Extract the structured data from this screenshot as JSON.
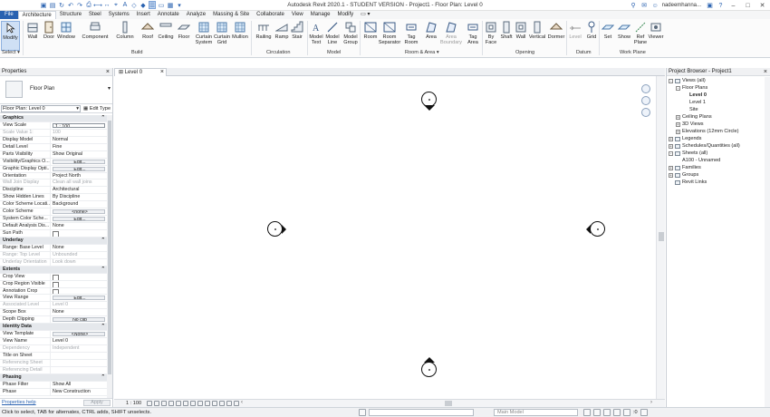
{
  "app": {
    "title": "Autodesk Revit 2020.1 - STUDENT VERSION - Project1 - Floor Plan: Level 0",
    "user": "nadeemhanna..."
  },
  "tabs": [
    "File",
    "Architecture",
    "Structure",
    "Steel",
    "Systems",
    "Insert",
    "Annotate",
    "Analyze",
    "Massing & Site",
    "Collaborate",
    "View",
    "Manage",
    "Modify"
  ],
  "active_tab": "Architecture",
  "ribbon": {
    "modify": "Modify",
    "select": "Select ▾",
    "build": {
      "label": "Build",
      "buttons": [
        "Wall",
        "Door",
        "Window",
        "Component",
        "Column",
        "Roof",
        "Ceiling",
        "Floor",
        "Curtain System",
        "Curtain Grid",
        "Mullion"
      ]
    },
    "circulation": {
      "label": "Circulation",
      "buttons": [
        "Railing",
        "Ramp",
        "Stair"
      ]
    },
    "model": {
      "label": "Model",
      "buttons": [
        "Model Text",
        "Model Line",
        "Model Group"
      ]
    },
    "room_area": {
      "label": "Room & Area ▾",
      "buttons": [
        "Room",
        "Room Separator",
        "Tag Room",
        "Area",
        "Area Boundary",
        "Tag Area"
      ]
    },
    "opening": {
      "label": "Opening",
      "buttons": [
        "By Face",
        "Shaft",
        "Wall",
        "Vertical",
        "Dormer"
      ]
    },
    "datum": {
      "label": "Datum",
      "buttons": [
        "Level",
        "Grid"
      ]
    },
    "work_plane": {
      "label": "Work Plane",
      "buttons": [
        "Set",
        "Show",
        "Ref Plane",
        "Viewer"
      ]
    }
  },
  "properties": {
    "title": "Properties",
    "type_name": "Floor Plan",
    "instance": "Floor Plan: Level 0",
    "edit_type": "Edit Type",
    "help": "Properties help",
    "apply": "Apply",
    "rows": [
      {
        "cat": "Graphics"
      },
      {
        "k": "View Scale",
        "v": "1 : 100",
        "style": "box"
      },
      {
        "k": "Scale Value    1:",
        "v": "100",
        "grey": true
      },
      {
        "k": "Display Model",
        "v": "Normal"
      },
      {
        "k": "Detail Level",
        "v": "Fine"
      },
      {
        "k": "Parts Visibility",
        "v": "Show Original"
      },
      {
        "k": "Visibility/Graphics O...",
        "v": "Edit...",
        "style": "btn"
      },
      {
        "k": "Graphic Display Opti...",
        "v": "Edit...",
        "style": "btn"
      },
      {
        "k": "Orientation",
        "v": "Project North"
      },
      {
        "k": "Wall Join Display",
        "v": "Clean all wall joins",
        "grey": true
      },
      {
        "k": "Discipline",
        "v": "Architectural"
      },
      {
        "k": "Show Hidden Lines",
        "v": "By Discipline"
      },
      {
        "k": "Color Scheme Locati...",
        "v": "Background"
      },
      {
        "k": "Color Scheme",
        "v": "<none>",
        "style": "btn"
      },
      {
        "k": "System Color Sche...",
        "v": "Edit...",
        "style": "btn"
      },
      {
        "k": "Default Analysis Dis...",
        "v": "None"
      },
      {
        "k": "Sun Path",
        "v": "",
        "style": "cb"
      },
      {
        "cat": "Underlay"
      },
      {
        "k": "Range: Base Level",
        "v": "None"
      },
      {
        "k": "Range: Top Level",
        "v": "Unbounded",
        "grey": true
      },
      {
        "k": "Underlay Orientation",
        "v": "Look down",
        "grey": true
      },
      {
        "cat": "Extents"
      },
      {
        "k": "Crop View",
        "v": "",
        "style": "cb"
      },
      {
        "k": "Crop Region Visible",
        "v": "",
        "style": "cb"
      },
      {
        "k": "Annotation Crop",
        "v": "",
        "style": "cb"
      },
      {
        "k": "View Range",
        "v": "Edit...",
        "style": "btn"
      },
      {
        "k": "Associated Level",
        "v": "Level 0",
        "grey": true
      },
      {
        "k": "Scope Box",
        "v": "None"
      },
      {
        "k": "Depth Clipping",
        "v": "No clip",
        "style": "btn"
      },
      {
        "cat": "Identity Data"
      },
      {
        "k": "View Template",
        "v": "<None>",
        "style": "btn"
      },
      {
        "k": "View Name",
        "v": "Level 0"
      },
      {
        "k": "Dependency",
        "v": "Independent",
        "grey": true
      },
      {
        "k": "Title on Sheet",
        "v": ""
      },
      {
        "k": "Referencing Sheet",
        "v": "",
        "grey": true
      },
      {
        "k": "Referencing Detail",
        "v": "",
        "grey": true
      },
      {
        "cat": "Phasing"
      },
      {
        "k": "Phase Filter",
        "v": "Show All"
      },
      {
        "k": "Phase",
        "v": "New Construction"
      }
    ]
  },
  "view": {
    "tab": "Level 0",
    "scale": "1 : 100"
  },
  "browser": {
    "title": "Project Browser - Project1",
    "tree": [
      {
        "t": "Views (all)",
        "lvl": 0,
        "exp": "-",
        "ico": true
      },
      {
        "t": "Floor Plans",
        "lvl": 1,
        "exp": "-"
      },
      {
        "t": "Level 0",
        "lvl": 2,
        "bold": true
      },
      {
        "t": "Level 1",
        "lvl": 2
      },
      {
        "t": "Site",
        "lvl": 2
      },
      {
        "t": "Ceiling Plans",
        "lvl": 1,
        "exp": "+"
      },
      {
        "t": "3D Views",
        "lvl": 1,
        "exp": "+"
      },
      {
        "t": "Elevations (12mm Circle)",
        "lvl": 1,
        "exp": "+"
      },
      {
        "t": "Legends",
        "lvl": 0,
        "exp": "+",
        "ico": true
      },
      {
        "t": "Schedules/Quantities (all)",
        "lvl": 0,
        "exp": "+",
        "ico": true
      },
      {
        "t": "Sheets (all)",
        "lvl": 0,
        "exp": "-",
        "ico": true
      },
      {
        "t": "A100 - Unnamed",
        "lvl": 1
      },
      {
        "t": "Families",
        "lvl": 0,
        "exp": "+",
        "ico": true
      },
      {
        "t": "Groups",
        "lvl": 0,
        "exp": "+",
        "ico": true
      },
      {
        "t": "Revit Links",
        "lvl": 0,
        "ico": true
      }
    ]
  },
  "status": {
    "message": "Click to select, TAB for alternates, CTRL adds, SHIFT unselects.",
    "model": "Main Model",
    "zero": ":0"
  }
}
